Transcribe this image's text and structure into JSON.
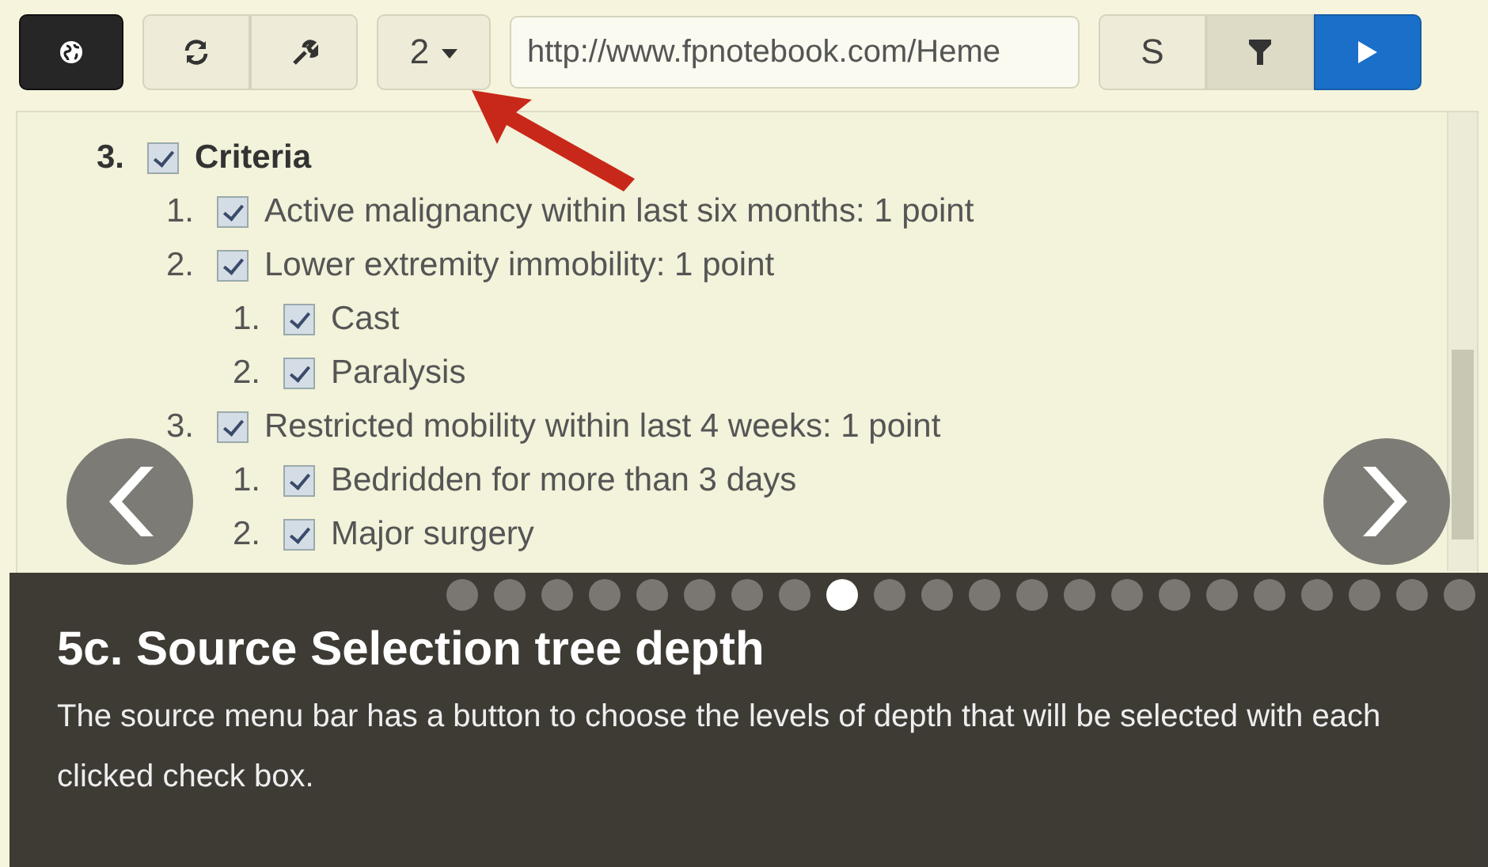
{
  "toolbar": {
    "buttons": [
      {
        "kind": "globe"
      },
      {
        "kind": "refresh"
      },
      {
        "kind": "wrench"
      }
    ],
    "depth_button": {
      "label": "2"
    },
    "url_field": {
      "value": "http://www.fpnotebook.com/Heme"
    },
    "right_buttons": [
      {
        "kind": "text",
        "label": "S",
        "selected": false
      },
      {
        "kind": "filter",
        "selected": true
      },
      {
        "kind": "play"
      }
    ]
  },
  "tree": [
    {
      "number": "3.",
      "label": "Criteria",
      "checked": true,
      "children": [
        {
          "number": "1.",
          "label": "Active malignancy within last six months: 1 point",
          "checked": true
        },
        {
          "number": "2.",
          "label": "Lower extremity immobility: 1 point",
          "checked": true,
          "children": [
            {
              "number": "1.",
              "label": "Cast",
              "checked": true
            },
            {
              "number": "2.",
              "label": "Paralysis",
              "checked": true
            }
          ]
        },
        {
          "number": "3.",
          "label": "Restricted mobility within last 4 weeks: 1 point",
          "checked": true,
          "children": [
            {
              "number": "1.",
              "label": "Bedridden for more than 3 days",
              "checked": true
            },
            {
              "number": "2.",
              "label": "Major surgery",
              "checked": true
            }
          ]
        }
      ]
    }
  ],
  "slides": {
    "dots": [
      {
        "selected": false
      },
      {
        "selected": false
      },
      {
        "selected": false
      },
      {
        "selected": false
      },
      {
        "selected": false
      },
      {
        "selected": false
      },
      {
        "selected": false
      },
      {
        "selected": false
      },
      {
        "selected": true
      },
      {
        "selected": false
      },
      {
        "selected": false
      },
      {
        "selected": false
      },
      {
        "selected": false
      },
      {
        "selected": false
      },
      {
        "selected": false
      },
      {
        "selected": false
      },
      {
        "selected": false
      },
      {
        "selected": false
      },
      {
        "selected": false
      },
      {
        "selected": false
      },
      {
        "selected": false
      },
      {
        "selected": false
      }
    ]
  },
  "caption": {
    "title": "5c. Source Selection tree depth",
    "text": "The source menu bar has a button to choose the levels of depth that will be selected with each clicked check box."
  }
}
